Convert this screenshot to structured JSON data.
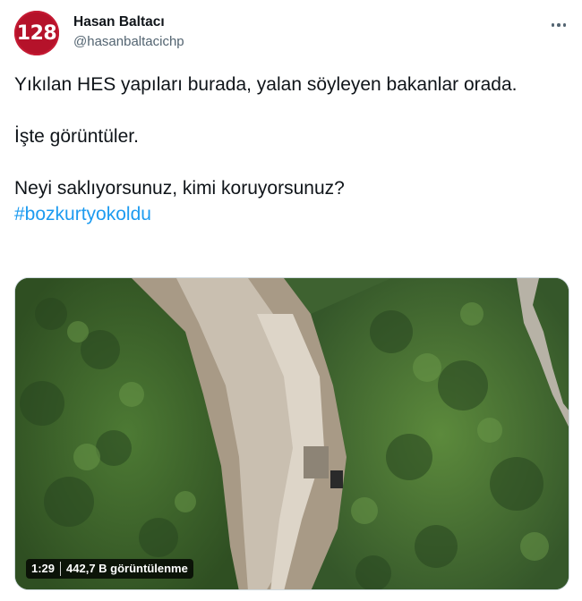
{
  "author": {
    "avatar_text": "128",
    "display_name": "Hasan Baltacı",
    "handle": "@hasanbaltacichp"
  },
  "tweet": {
    "line1": "Yıkılan HES yapıları burada, yalan söyleyen bakanlar orada.",
    "line2": "İşte görüntüler.",
    "line3": "Neyi saklıyorsunuz, kimi koruyorsunuz?",
    "hashtag": "#bozkurtyokoldu"
  },
  "video": {
    "duration": "1:29",
    "views": "442,7 B görüntülenme"
  },
  "colors": {
    "hashtag": "#1d9bf0",
    "avatar": "#b5122a",
    "secondary_text": "#536471"
  }
}
